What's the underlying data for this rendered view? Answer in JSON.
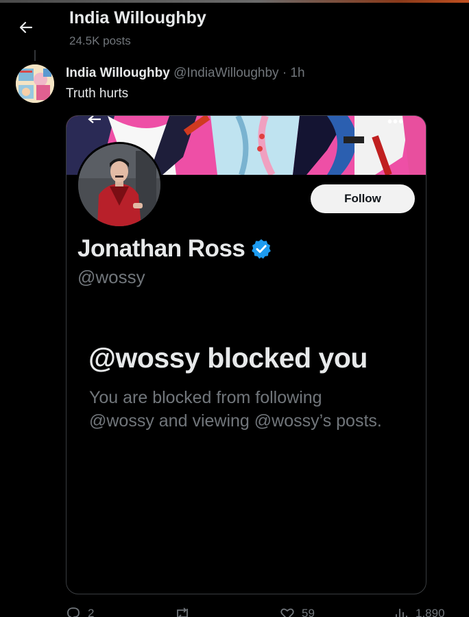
{
  "header": {
    "back_icon": "arrow-left-icon",
    "name": "India Willoughby",
    "post_count": "24.5K posts"
  },
  "tweet": {
    "author_name": "India Willoughby",
    "author_handle": "@IndiaWilloughby",
    "separator": "·",
    "time": "1h",
    "text": "Truth hurts",
    "embedded_screenshot": {
      "follow_label": "Follow",
      "profile_name": "Jonathan Ross",
      "profile_handle": "@wossy",
      "blocked_title": "@wossy blocked you",
      "blocked_description": "You are blocked from following @wossy and viewing @wossy’s posts.",
      "verified_color": "#1d9bf0"
    },
    "actions": {
      "replies": "2",
      "retweets": "",
      "likes": "59",
      "views": "1,890"
    }
  },
  "colors": {
    "background": "#000000",
    "primary_text": "#e7e9ea",
    "secondary_text": "#71767b",
    "accent": "#1d9bf0"
  }
}
